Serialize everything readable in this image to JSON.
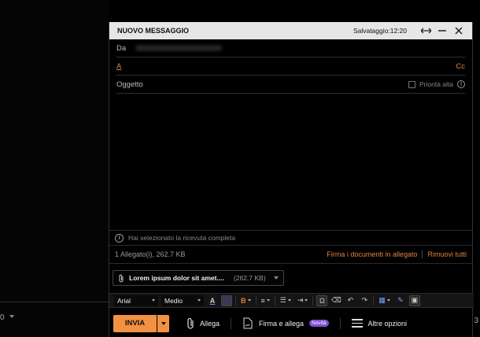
{
  "background": {
    "fragment_left": "0",
    "fragment_right": "3"
  },
  "window": {
    "title": "NUOVO MESSAGGIO",
    "saved": "Salvataggio:12:20",
    "icons": [
      "expand-horizontal-icon",
      "minimize-icon",
      "close-icon"
    ]
  },
  "fields": {
    "from_label": "Da",
    "to_label": "A",
    "cc_label": "Cc",
    "subject_label": "Oggetto",
    "priority_label": "Priorità alta"
  },
  "notice": {
    "text": "Hai selezionato la ricevuta completa"
  },
  "attachments": {
    "count_label": "1 Allegato(i), 262.7 KB",
    "sign_link": "Firma i documenti in allegato",
    "remove_link": "Rimuovi tutti",
    "file_name": "Lorem ipsum dolor sit amet....",
    "file_size": "(262.7 KB)"
  },
  "formatting": {
    "font": "Arial",
    "size": "Medio",
    "bold_glyph": "B"
  },
  "actions": {
    "send": "INVIA",
    "attach": "Allega",
    "sign_attach": "Firma e allega",
    "new_badge": "Novità",
    "more": "Altre opzioni"
  },
  "colors": {
    "accent": "#f29142",
    "link": "#e0833c",
    "badge": "#7d4fd6",
    "titlebar": "#e6e6e6"
  }
}
